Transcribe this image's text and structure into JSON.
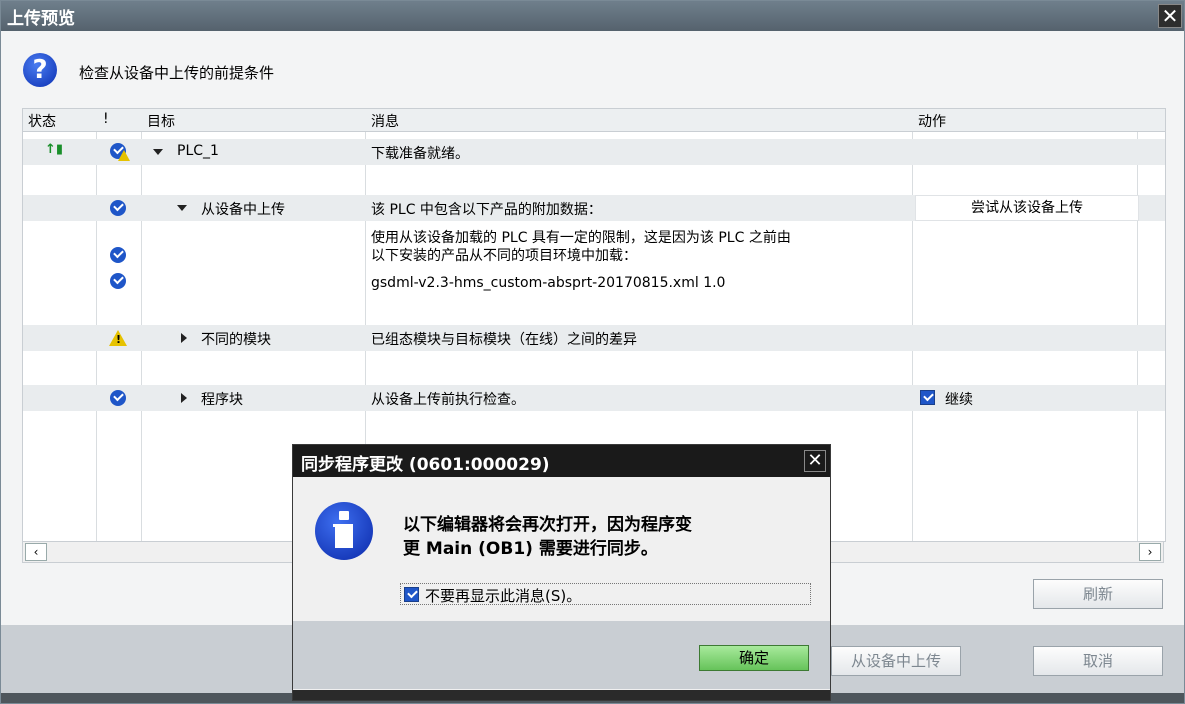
{
  "window": {
    "title": "上传预览",
    "close_glyph": "✕",
    "header_icon": "question-icon",
    "header_text": "检查从设备中上传的前提条件"
  },
  "table": {
    "columns": [
      "状态",
      "!",
      "目标",
      "消息",
      "动作"
    ],
    "rows": [
      {
        "target": "PLC_1",
        "message": "下载准备就绪。",
        "status_icon": "upload-status-icon",
        "flag_icon": "check-warning-icon"
      },
      {
        "target": "从设备中上传",
        "message": "该 PLC 中包含以下产品的附加数据：",
        "action": "尝试从该设备上传",
        "flag_icon": "check-icon"
      },
      {
        "message_line1": "使用从该设备加载的 PLC 具有一定的限制，这是因为该 PLC 之前由",
        "message_line2": "以下安装的产品从不同的项目环境中加载：",
        "flag_icon": "check-icon"
      },
      {
        "message": "gsdml-v2.3-hms_custom-absprt-20170815.xml 1.0",
        "flag_icon": "check-icon"
      },
      {
        "target": "不同的模块",
        "message": "已组态模块与目标模块（在线）之间的差异",
        "flag_icon": "warning-icon"
      },
      {
        "target": "程序块",
        "message": "从设备上传前执行检查。",
        "action": "继续",
        "action_checked": true,
        "flag_icon": "check-icon"
      }
    ]
  },
  "scrollbar": {
    "left_glyph": "‹",
    "right_glyph": "›"
  },
  "buttons": {
    "refresh": "刷新",
    "upload": "从设备中上传",
    "cancel": "取消"
  },
  "dialog": {
    "title": "同步程序更改 (0601:000029)",
    "close_glyph": "✕",
    "icon": "info-icon",
    "message_line1": "以下编辑器将会再次打开，因为程序变",
    "message_line2": "更 Main (OB1) 需要进行同步。",
    "checkbox_label": "不要再显示此消息(S)。",
    "checkbox_checked": true,
    "ok": "确定"
  }
}
